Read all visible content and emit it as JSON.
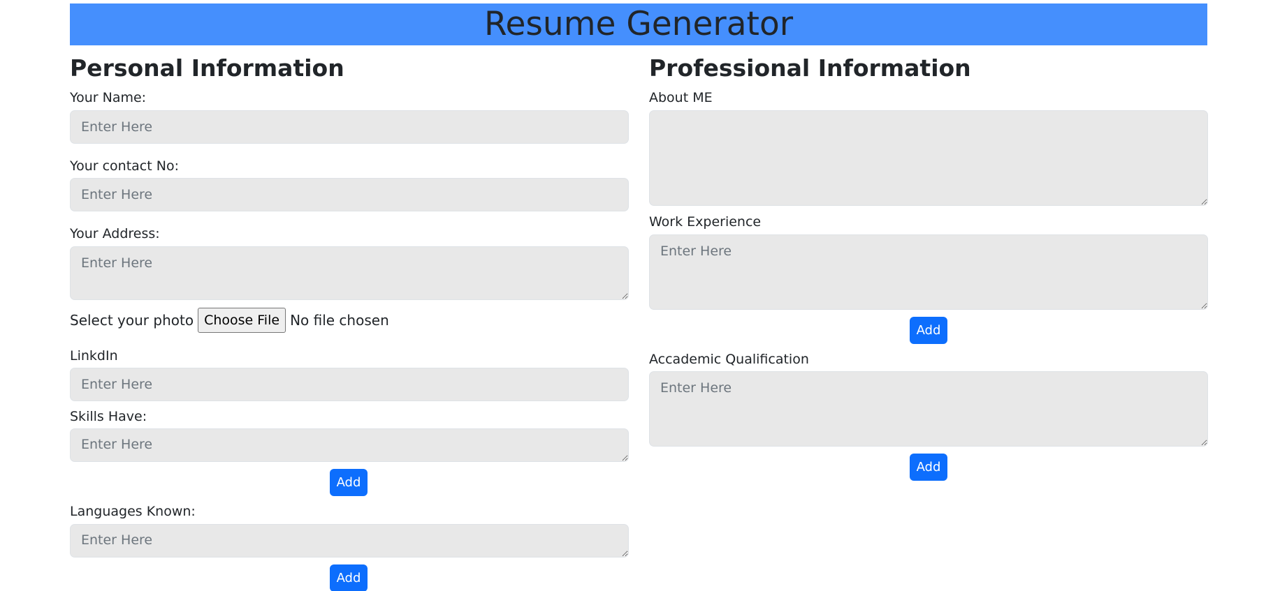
{
  "header": {
    "title": "Resume Generator"
  },
  "personal": {
    "title": "Personal Information",
    "name_label": "Your Name:",
    "name_placeholder": "Enter Here",
    "contact_label": "Your contact No:",
    "contact_placeholder": "Enter Here",
    "address_label": "Your Address:",
    "address_placeholder": "Enter Here",
    "photo_label": "Select your photo",
    "choose_file_label": "Choose File",
    "no_file_text": "No file chosen",
    "linkedin_label": "LinkdIn",
    "linkedin_placeholder": "Enter Here",
    "skills_label": "Skills Have:",
    "skills_placeholder": "Enter Here",
    "skills_add": "Add",
    "languages_label": "Languages Known:",
    "languages_placeholder": "Enter Here",
    "languages_add": "Add"
  },
  "professional": {
    "title": "Professional Information",
    "about_label": "About ME",
    "about_placeholder": "",
    "work_label": "Work Experience",
    "work_placeholder": "Enter Here",
    "work_add": "Add",
    "academic_label": "Accademic Qualification",
    "academic_placeholder": "Enter Here",
    "academic_add": "Add"
  },
  "colors": {
    "header_bg": "#458ffd",
    "button_bg": "#0d6efd",
    "field_bg": "#e8e8e8"
  }
}
